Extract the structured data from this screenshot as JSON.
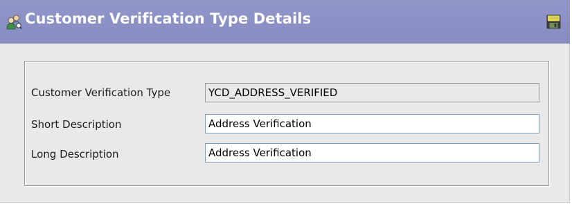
{
  "header": {
    "title": "Customer Verification Type Details",
    "title_icon": "users-group-icon",
    "save_icon": "floppy-disk-icon"
  },
  "form": {
    "fields": [
      {
        "label": "Customer Verification Type",
        "value": "YCD_ADDRESS_VERIFIED",
        "readonly": true
      },
      {
        "label": "Short Description",
        "value": "Address Verification",
        "readonly": false
      },
      {
        "label": "Long Description",
        "value": "Address Verification",
        "readonly": false
      }
    ]
  },
  "colors": {
    "titlebar": "#8a90c4",
    "panel_background": "#e9e9e9",
    "input_border": "#7f9db9"
  }
}
